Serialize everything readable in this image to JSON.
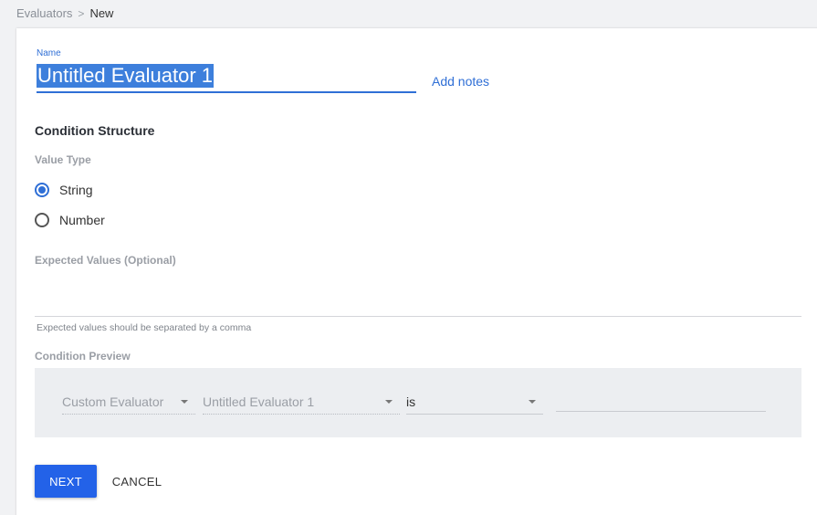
{
  "breadcrumb": {
    "parent": "Evaluators",
    "separator": ">",
    "current": "New"
  },
  "form": {
    "name_label": "Name",
    "name_value": "Untitled Evaluator 1",
    "add_notes": "Add notes",
    "condition_structure": "Condition Structure",
    "value_type_label": "Value Type",
    "value_type_options": [
      {
        "label": "String",
        "selected": true
      },
      {
        "label": "Number",
        "selected": false
      }
    ],
    "expected_values_label": "Expected Values (Optional)",
    "expected_values_value": "",
    "expected_values_helper": "Expected values should be separated by a comma",
    "condition_preview_label": "Condition Preview",
    "preview": {
      "source": "Custom Evaluator",
      "evaluator": "Untitled Evaluator 1",
      "operator": "is",
      "value": ""
    }
  },
  "actions": {
    "next": "NEXT",
    "cancel": "CANCEL"
  },
  "colors": {
    "accent": "#2f6fd6",
    "primary_button": "#2362e8",
    "preview_bg": "#eceef1"
  }
}
